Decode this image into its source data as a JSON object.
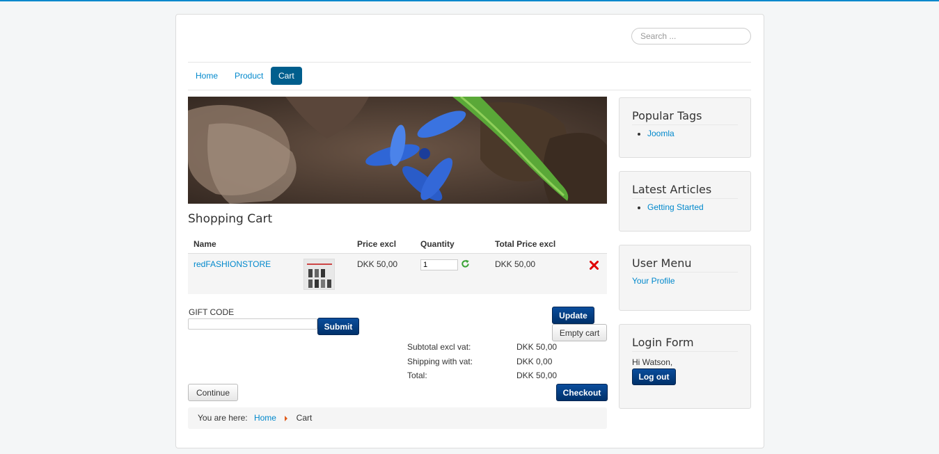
{
  "search": {
    "placeholder": "Search ..."
  },
  "nav": {
    "items": [
      {
        "label": "Home"
      },
      {
        "label": "Product"
      },
      {
        "label": "Cart"
      }
    ]
  },
  "page_title": "Shopping Cart",
  "cart": {
    "columns": [
      "Name",
      "",
      "Price excl",
      "Quantity",
      "Total Price excl",
      ""
    ],
    "items": [
      {
        "name": "redFASHIONSTORE",
        "price": "DKK 50,00",
        "quantity": "1",
        "total": "DKK 50,00"
      }
    ]
  },
  "gift": {
    "label": "GIFT CODE",
    "submit": "Submit"
  },
  "buttons": {
    "update": "Update",
    "empty_cart": "Empty cart",
    "continue": "Continue",
    "checkout": "Checkout"
  },
  "totals": {
    "subtotal_label": "Subtotal excl vat:",
    "subtotal_value": "DKK 50,00",
    "shipping_label": "Shipping with vat:",
    "shipping_value": "DKK 0,00",
    "total_label": "Total:",
    "total_value": "DKK 50,00"
  },
  "breadcrumb": {
    "prefix": "You are here:",
    "home": "Home",
    "current": "Cart"
  },
  "sidebar": {
    "popular_tags": {
      "title": "Popular Tags",
      "items": [
        "Joomla"
      ]
    },
    "latest_articles": {
      "title": "Latest Articles",
      "items": [
        "Getting Started"
      ]
    },
    "user_menu": {
      "title": "User Menu",
      "link": "Your Profile"
    },
    "login_form": {
      "title": "Login Form",
      "greeting": "Hi Watson,",
      "logout": "Log out"
    }
  },
  "icons": {
    "refresh": "refresh-icon",
    "delete": "delete-x-icon"
  },
  "colors": {
    "accent": "#005e8d",
    "link": "#0088cc",
    "primary_button": "#00316a",
    "delete": "#e00000",
    "refresh": "#3aa335"
  }
}
